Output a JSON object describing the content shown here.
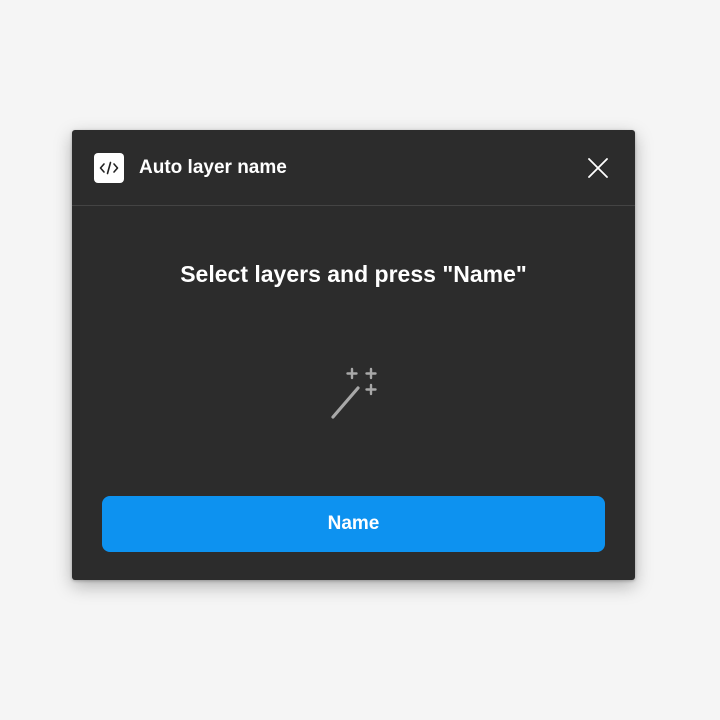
{
  "dialog": {
    "title": "Auto layer name",
    "icon": "code-brackets-icon",
    "close_icon": "close-icon"
  },
  "main": {
    "instruction": "Select layers and press \"Name\"",
    "illustration_icon": "magic-wand-icon"
  },
  "actions": {
    "name_button_label": "Name"
  },
  "colors": {
    "page_background": "#f5f5f5",
    "dialog_background": "#2c2c2c",
    "divider": "#444444",
    "primary_button": "#0d92f0",
    "text": "#ffffff",
    "icon_muted": "#9a9a9a"
  }
}
